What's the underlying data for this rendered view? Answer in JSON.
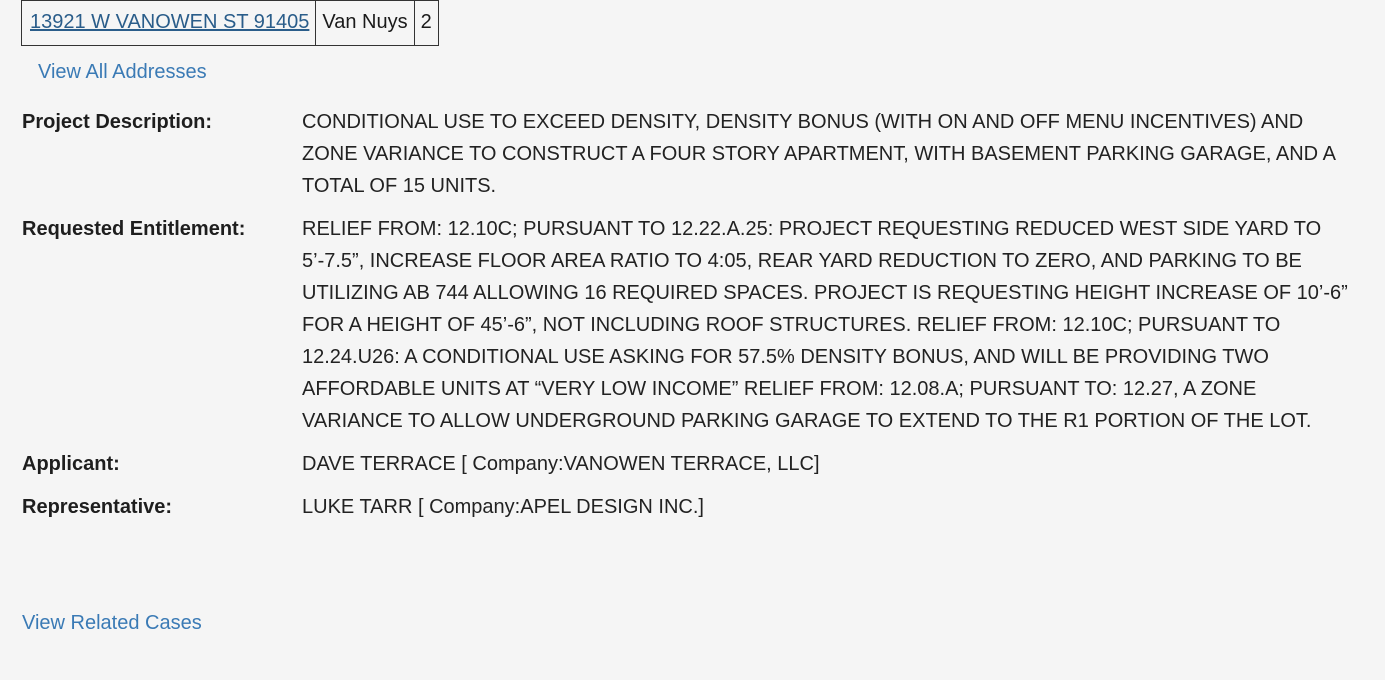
{
  "address_table": {
    "address": "13921 W VANOWEN ST 91405",
    "community": "Van Nuys",
    "district": "2"
  },
  "view_all_addresses": "View All Addresses",
  "details": [
    {
      "label": "Project Description:",
      "value": "CONDITIONAL USE TO EXCEED DENSITY, DENSITY BONUS (WITH ON AND OFF MENU INCENTIVES) AND ZONE VARIANCE TO CONSTRUCT A FOUR STORY APARTMENT, WITH BASEMENT PARKING GARAGE, AND A TOTAL OF 15 UNITS."
    },
    {
      "label": "Requested Entitlement:",
      "value": "RELIEF FROM: 12.10C; PURSUANT TO 12.22.A.25: PROJECT REQUESTING REDUCED WEST SIDE YARD TO 5’-7.5”, INCREASE FLOOR AREA RATIO TO 4:05, REAR YARD REDUCTION TO ZERO, AND PARKING TO BE UTILIZING AB 744 ALLOWING 16 REQUIRED SPACES. PROJECT IS REQUESTING HEIGHT INCREASE OF 10’-6” FOR A HEIGHT OF 45’-6”, NOT INCLUDING ROOF STRUCTURES. RELIEF FROM: 12.10C; PURSUANT TO 12.24.U26: A CONDITIONAL USE ASKING FOR 57.5% DENSITY BONUS, AND WILL BE PROVIDING TWO AFFORDABLE UNITS AT “VERY LOW INCOME” RELIEF FROM: 12.08.A; PURSUANT TO: 12.27, A ZONE VARIANCE TO ALLOW UNDERGROUND PARKING GARAGE TO EXTEND TO THE R1 PORTION OF THE LOT."
    },
    {
      "label": "Applicant:",
      "value": "DAVE TERRACE [ Company:VANOWEN TERRACE, LLC]"
    },
    {
      "label": "Representative:",
      "value": "LUKE TARR [ Company:APEL DESIGN INC.]"
    }
  ],
  "view_related_cases": "View Related Cases"
}
